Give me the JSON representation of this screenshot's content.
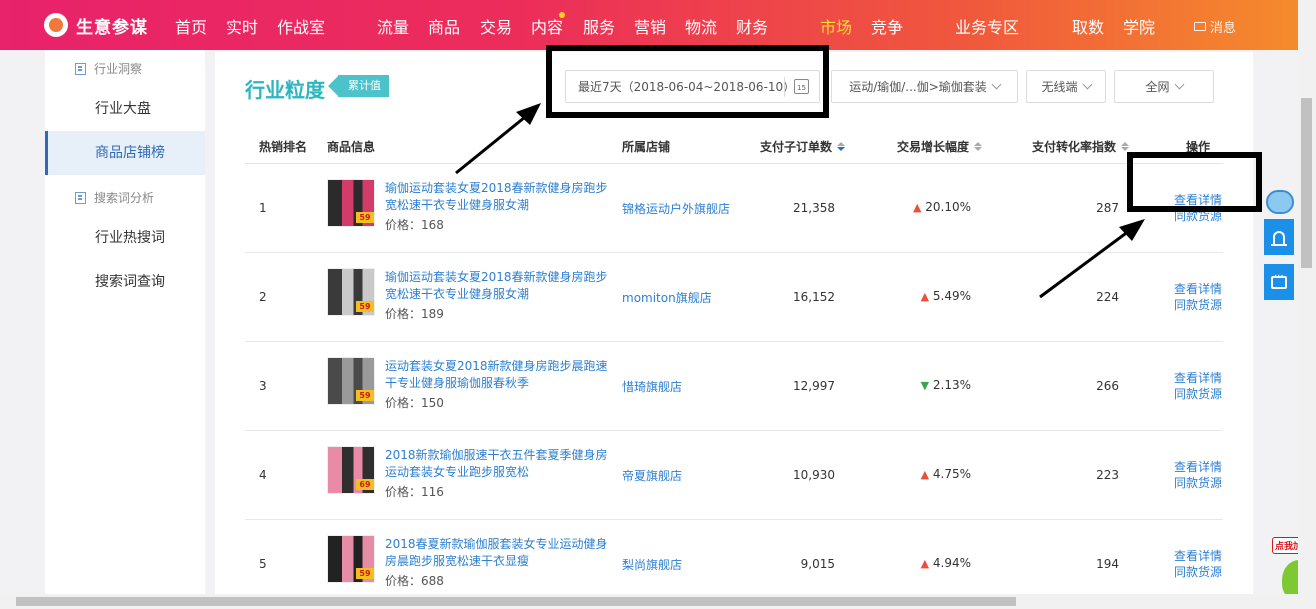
{
  "brand": "生意参谋",
  "nav": {
    "items": [
      "首页",
      "实时",
      "作战室",
      "流量",
      "商品",
      "交易",
      "内容",
      "服务",
      "营销",
      "物流",
      "财务",
      "市场",
      "竞争",
      "业务专区",
      "取数",
      "学院"
    ],
    "active": "市场",
    "message": "消息"
  },
  "sidebar": {
    "group1": "行业洞察",
    "items1": [
      "行业大盘",
      "商品店铺榜"
    ],
    "group2": "搜索词分析",
    "items2": [
      "行业热搜词",
      "搜索词查询"
    ],
    "active": "商品店铺榜"
  },
  "panel": {
    "title": "行业粒度",
    "badge": "累计值",
    "date_range": "最近7天（2018-06-04~2018-06-10）",
    "calendar_day": "15",
    "category": "运动/瑜伽/...伽>瑜伽套装",
    "device": "无线端",
    "network": "全网"
  },
  "table": {
    "headers": [
      "热销排名",
      "商品信息",
      "所属店铺",
      "支付子订单数",
      "交易增长幅度",
      "支付转化率指数",
      "操作"
    ],
    "price_prefix": "价格：",
    "rows": [
      {
        "rank": "1",
        "title": "瑜伽运动套装女夏2018春新款健身房跑步宽松速干衣专业健身服女潮",
        "price": "168",
        "shop": "锦格运动户外旗舰店",
        "orders": "21,358",
        "growth": "20.10%",
        "direction": "up",
        "conversion": "287",
        "op1": "查看详情",
        "op2": "同款货源"
      },
      {
        "rank": "2",
        "title": "瑜伽运动套装女夏2018春新款健身房跑步宽松速干衣专业健身服女潮",
        "price": "189",
        "shop": "momiton旗舰店",
        "orders": "16,152",
        "growth": "5.49%",
        "direction": "up",
        "conversion": "224",
        "op1": "查看详情",
        "op2": "同款货源"
      },
      {
        "rank": "3",
        "title": "运动套装女夏2018新款健身房跑步晨跑速干专业健身服瑜伽服春秋季",
        "price": "150",
        "shop": "惜琦旗舰店",
        "orders": "12,997",
        "growth": "2.13%",
        "direction": "down",
        "conversion": "266",
        "op1": "查看详情",
        "op2": "同款货源"
      },
      {
        "rank": "4",
        "title": "2018新款瑜伽服速干衣五件套夏季健身房运动套装女专业跑步服宽松",
        "price": "116",
        "shop": "帝夏旗舰店",
        "orders": "10,930",
        "growth": "4.75%",
        "direction": "up",
        "conversion": "223",
        "op1": "查看详情",
        "op2": "同款货源"
      },
      {
        "rank": "5",
        "title": "2018春夏新款瑜伽服套装女专业运动健身房晨跑步服宽松速干衣显瘦",
        "price": "688",
        "shop": "梨尚旗舰店",
        "orders": "9,015",
        "growth": "4.94%",
        "direction": "up",
        "conversion": "194",
        "op1": "查看详情",
        "op2": "同款货源"
      }
    ]
  },
  "widgets": {
    "speedup": "点我加速"
  },
  "thumb_tags": [
    "59",
    "59",
    "59",
    "69",
    "59"
  ]
}
